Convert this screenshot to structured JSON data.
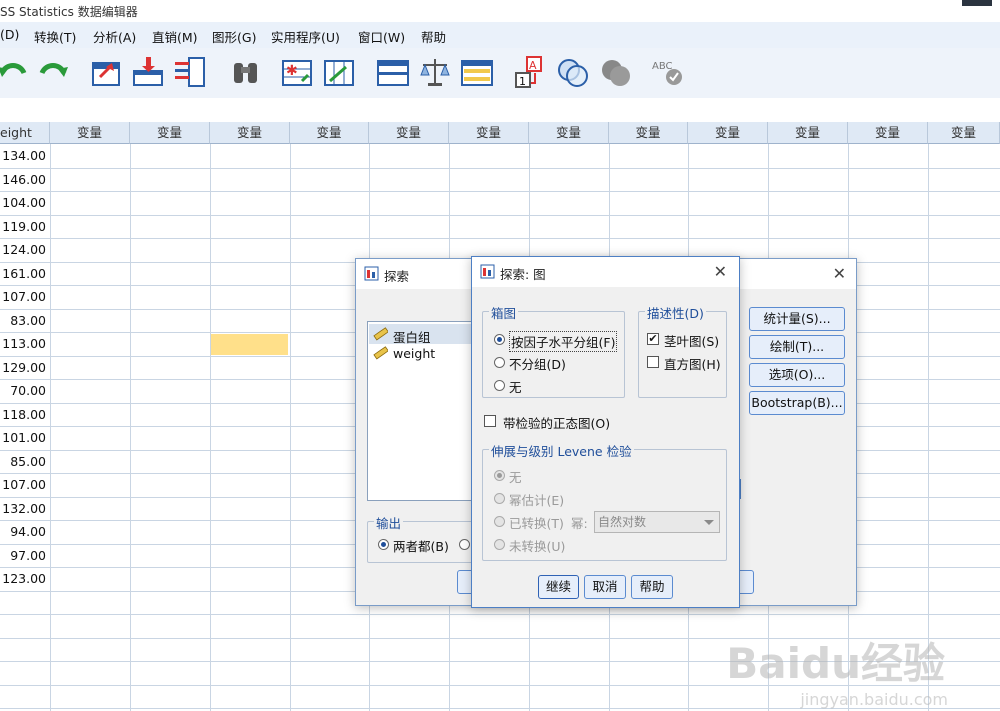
{
  "app": {
    "title": "SS Statistics 数据编辑器"
  },
  "menu": [
    {
      "label": "(D)"
    },
    {
      "label": "转换(T)"
    },
    {
      "label": "分析(A)"
    },
    {
      "label": "直销(M)"
    },
    {
      "label": "图形(G)"
    },
    {
      "label": "实用程序(U)"
    },
    {
      "label": "窗口(W)"
    },
    {
      "label": "帮助"
    }
  ],
  "toolbar": {
    "icons": [
      "undo-icon",
      "redo-icon",
      "goto-case-icon",
      "goto-variable-icon",
      "variables-icon",
      "find-icon",
      "insert-cases-icon",
      "insert-variable-icon",
      "split-file-icon",
      "weight-cases-icon",
      "select-cases-icon",
      "value-labels-icon",
      "use-sets-icon",
      "show-all-variables-icon",
      "spelling-icon"
    ],
    "spell_label": "ABC"
  },
  "grid": {
    "first_header": "eight",
    "var_header": "变量",
    "values": [
      "134.00",
      "146.00",
      "104.00",
      "119.00",
      "124.00",
      "161.00",
      "107.00",
      "83.00",
      "113.00",
      "129.00",
      "70.00",
      "118.00",
      "101.00",
      "85.00",
      "107.00",
      "132.00",
      "94.00",
      "97.00",
      "123.00"
    ]
  },
  "explore_dialog": {
    "title": "探索",
    "variables": [
      {
        "name": "蛋白组",
        "icon": "ruler-icon"
      },
      {
        "name": "weight",
        "icon": "ruler-icon"
      }
    ],
    "buttons": {
      "statistics": "统计量(S)...",
      "plots": "绘制(T)...",
      "options": "选项(O)...",
      "bootstrap": "Bootstrap(B)..."
    },
    "output_group": "输出",
    "output_both": "两者都(B)"
  },
  "plots_dialog": {
    "title": "探索: 图",
    "boxplot_group": "箱图",
    "boxplot_options": [
      "按因子水平分组(F)",
      "不分组(D)",
      "无"
    ],
    "boxplot_selected": 0,
    "descriptive_group": "描述性(D)",
    "stem_leaf": "茎叶图(S)",
    "stem_leaf_checked": true,
    "histogram": "直方图(H)",
    "histogram_checked": false,
    "normality": "带检验的正态图(O)",
    "normality_checked": false,
    "levene_group": "伸展与级别 Levene 检验",
    "levene_none": "无",
    "levene_power": "幂估计(E)",
    "levene_transformed": "已转换(T)",
    "power_label": "幂:",
    "power_value": "自然对数",
    "levene_untransformed": "未转换(U)",
    "btn_continue": "继续",
    "btn_cancel": "取消",
    "btn_help": "帮助"
  },
  "watermark": {
    "main": "Baidu经验",
    "sub": "jingyan.baidu.com"
  },
  "colors": {
    "accent": "#1f4e9a",
    "header_bg": "#dfe9f5",
    "highlight_cell": "#ffe08a",
    "button_border": "#5b8bd0"
  }
}
